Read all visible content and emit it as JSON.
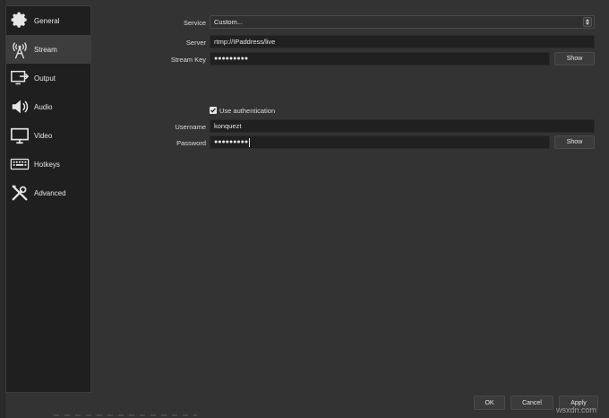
{
  "sidebar": {
    "items": [
      {
        "label": "General",
        "icon": "gear-icon"
      },
      {
        "label": "Stream",
        "icon": "antenna-icon"
      },
      {
        "label": "Output",
        "icon": "output-icon"
      },
      {
        "label": "Audio",
        "icon": "speaker-icon"
      },
      {
        "label": "Video",
        "icon": "monitor-icon"
      },
      {
        "label": "Hotkeys",
        "icon": "keyboard-icon"
      },
      {
        "label": "Advanced",
        "icon": "tools-icon"
      }
    ],
    "active": "Stream"
  },
  "form": {
    "service_label": "Service",
    "service_value": "Custom...",
    "server_label": "Server",
    "server_value": "rtmp://IPaddress/live",
    "stream_key_label": "Stream Key",
    "stream_key_value": "●●●●●●●●●",
    "stream_key_show": "Show",
    "auth_label": "Use authentication",
    "auth_checked": true,
    "username_label": "Username",
    "username_value": "konquezt",
    "password_label": "Password",
    "password_value": "●●●●●●●●●",
    "password_show": "Show"
  },
  "footer": {
    "ok": "OK",
    "cancel": "Cancel",
    "apply": "Apply"
  },
  "watermark": "wsxdn.com"
}
